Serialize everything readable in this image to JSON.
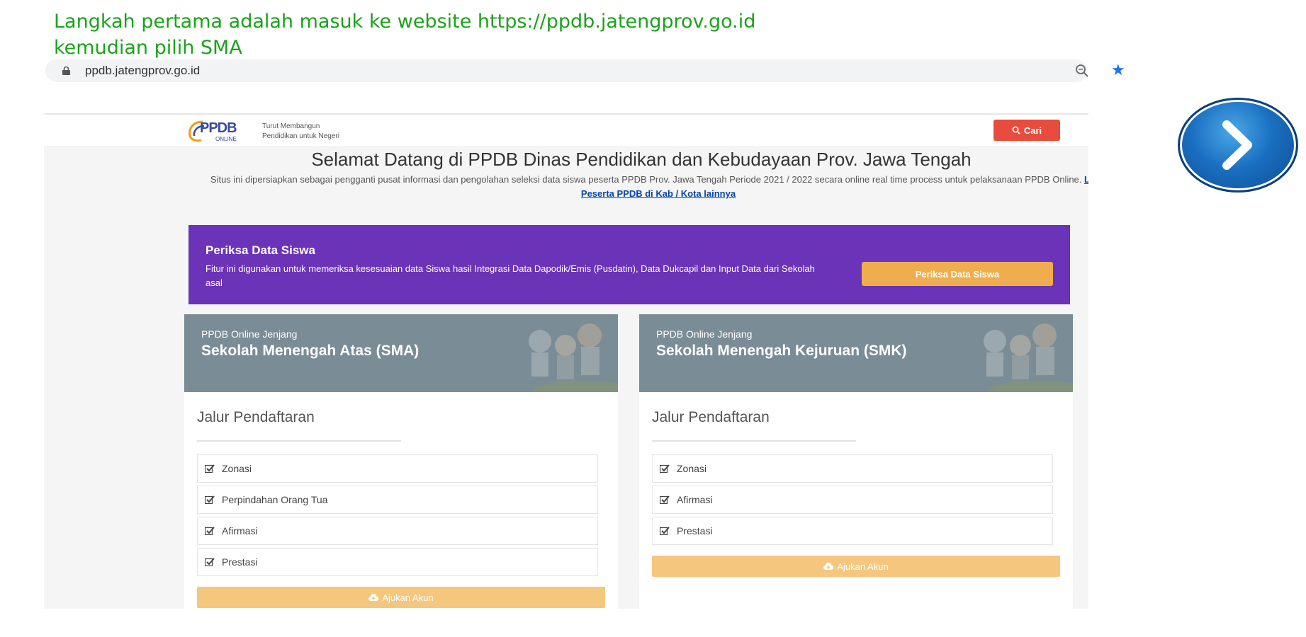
{
  "caption": {
    "line1": "Langkah pertama adalah masuk ke website https://ppdb.jatengprov.go.id",
    "line2": "kemudian pilih SMA"
  },
  "browser": {
    "url": "ppdb.jatengprov.go.id",
    "icons": [
      "lock-icon",
      "zoom-icon",
      "star-icon"
    ],
    "accent": "#1a73e8"
  },
  "site": {
    "logo_text": "PPDB",
    "logo_sub": "ONLINE",
    "tagline_line1": "Turut Membangun",
    "tagline_line2": "Pendidikan untuk Negeri",
    "search_label": "Cari",
    "welcome_title": "Selamat Datang di PPDB Dinas Pendidikan dan Kebudayaan Prov. Jawa Tengah",
    "intro_text": "Situs ini dipersiapkan sebagai pengganti pusat informasi dan pengolahan seleksi data siswa peserta PPDB Prov. Jawa Tengah Periode 2021 / 2022 secara online real time process untuk pelaksanaan PPDB Online.",
    "intro_link": "Lihat Peserta PPDB di Kab / Kota lainnya",
    "check_panel": {
      "title": "Periksa Data Siswa",
      "description": "Fitur ini digunakan untuk memeriksa kesesuaian data Siswa hasil Integrasi Data Dapodik/Emis (Pusdatin), Data Dukcapil dan Input Data dari Sekolah asal",
      "button": "Periksa Data Siswa",
      "color": "#6a33b8"
    },
    "cards": [
      {
        "sub": "PPDB Online Jenjang",
        "title": "Sekolah Menengah Atas (SMA)",
        "section": "Jalur Pendaftaran",
        "items": [
          "Zonasi",
          "Perpindahan Orang Tua",
          "Afirmasi",
          "Prestasi"
        ],
        "button": "Ajukan Akun"
      },
      {
        "sub": "PPDB Online Jenjang",
        "title": "Sekolah Menengah Kejuruan (SMK)",
        "section": "Jalur Pendaftaran",
        "items": [
          "Zonasi",
          "Afirmasi",
          "Prestasi"
        ],
        "button": "Ajukan Akun"
      }
    ]
  },
  "next_button": {
    "icon": "chevron-right-icon",
    "color": "#1a6fc0"
  }
}
